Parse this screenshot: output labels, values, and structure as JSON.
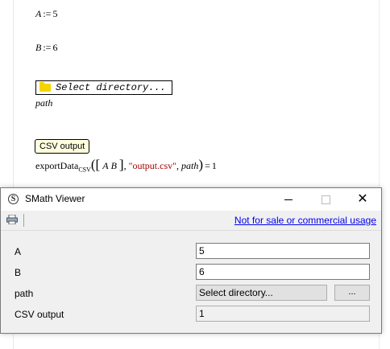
{
  "worksheet": {
    "a_def": {
      "var": "A",
      "op": ":=",
      "value": "5"
    },
    "b_def": {
      "var": "B",
      "op": ":=",
      "value": "6"
    },
    "dir_widget_label": "Select directory...",
    "path_var": "path",
    "csv_tag": "CSV output",
    "export": {
      "func": "exportData",
      "sub": "CSV",
      "arg_a": "A",
      "arg_b": "B",
      "filename": "\"output.csv\"",
      "arg_path": "path",
      "result": "1"
    }
  },
  "viewer": {
    "title": "SMath Viewer",
    "app_icon_letter": "S",
    "close_glyph": "✕",
    "license_link": "Not for sale or commercial usage",
    "rows": {
      "a": {
        "label": "A",
        "value": "5"
      },
      "b": {
        "label": "B",
        "value": "6"
      },
      "path": {
        "label": "path",
        "button": "Select directory...",
        "browse": "..."
      },
      "csv": {
        "label": "CSV output",
        "value": "1"
      }
    }
  },
  "colors": {
    "string": "#a00000",
    "link": "#0000ee",
    "folder": "#f5d400",
    "tag_bg": "#ffffe0"
  },
  "icons": [
    "app-icon",
    "print-icon",
    "folder-icon",
    "minimize-icon",
    "maximize-icon",
    "close-icon"
  ]
}
